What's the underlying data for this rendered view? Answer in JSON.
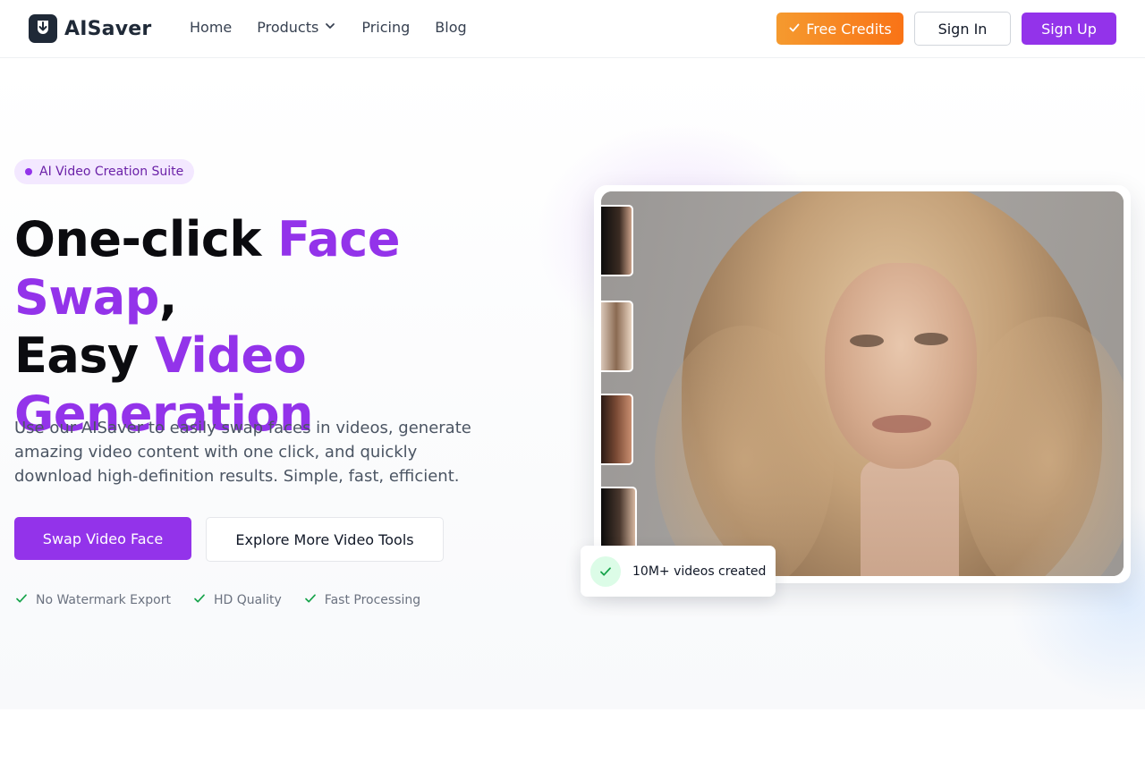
{
  "brand": {
    "name": "AISaver",
    "logo_icon": "download-shield-icon"
  },
  "nav": {
    "items": [
      {
        "label": "Home"
      },
      {
        "label": "Products",
        "has_dropdown": true
      },
      {
        "label": "Pricing"
      },
      {
        "label": "Blog"
      }
    ]
  },
  "header_actions": {
    "free_credits": "Free Credits",
    "sign_in": "Sign In",
    "sign_up": "Sign Up"
  },
  "hero": {
    "badge": "AI Video Creation Suite",
    "headline": {
      "part1": "One-click ",
      "accent1": "Face Swap",
      "part2": ",",
      "part3": "Easy ",
      "accent2": "Video",
      "accent3": "Generation"
    },
    "description": "Use our AISaver to easily swap faces in videos, generate amazing video content with one click, and quickly download high-definition results. Simple, fast, efficient.",
    "primary_cta": "Swap Video Face",
    "secondary_cta": "Explore More Video Tools",
    "features": [
      "No Watermark Export",
      "HD Quality",
      "Fast Processing"
    ]
  },
  "media": {
    "stat_badge": "10M+ videos created"
  },
  "colors": {
    "accent": "#9333ea",
    "orange": "#f97316",
    "success": "#16a34a"
  }
}
